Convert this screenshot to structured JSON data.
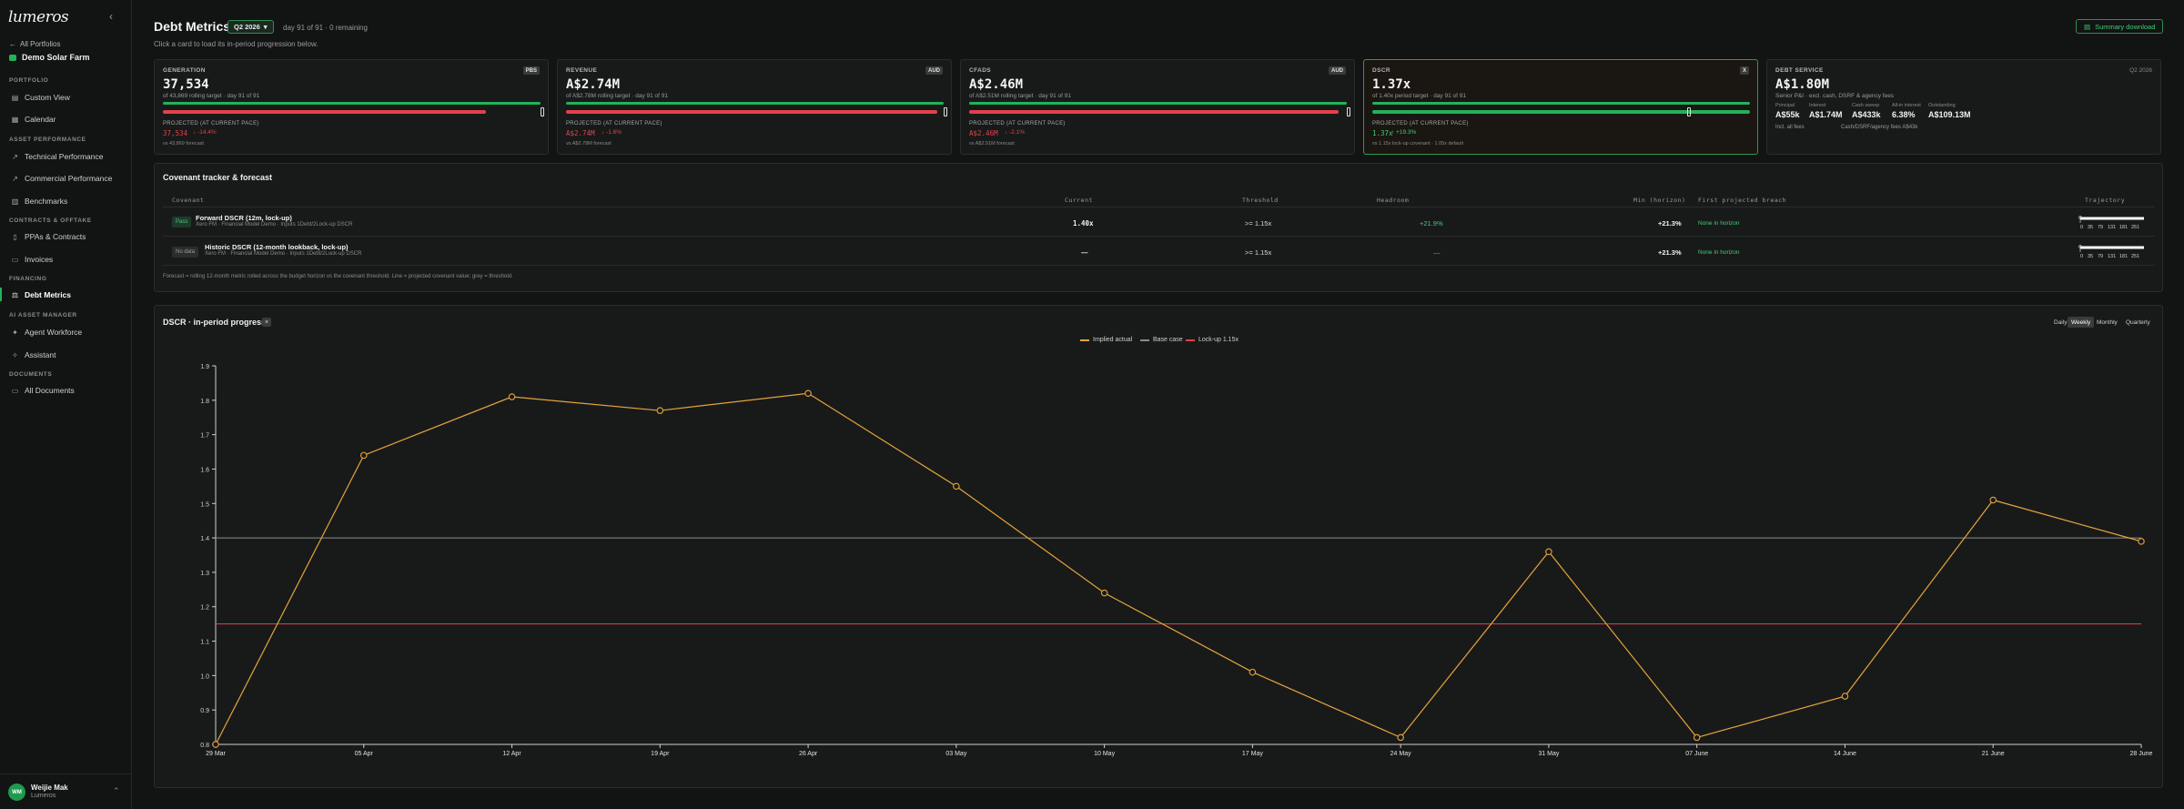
{
  "sidebar": {
    "logo": "lumeros",
    "back_label": "All Portfolios",
    "site_name": "Demo Solar Farm",
    "sections": {
      "portfolio": "PORTFOLIO",
      "asset_performance": "ASSET PERFORMANCE",
      "contracts": "CONTRACTS & OFFTAKE",
      "financing": "FINANCING",
      "ai": "AI ASSET MANAGER",
      "documents": "DOCUMENTS"
    },
    "items": {
      "custom_view": "Custom View",
      "calendar": "Calendar",
      "technical": "Technical Performance",
      "commercial": "Commercial Performance",
      "benchmarks": "Benchmarks",
      "ppas": "PPAs & Contracts",
      "invoices": "Invoices",
      "debt_metrics": "Debt Metrics",
      "agent_workforce": "Agent Workforce",
      "assistant": "Assistant",
      "all_documents": "All Documents"
    },
    "user": {
      "initials": "WM",
      "name": "Weijie Mak",
      "org": "Lumeros"
    }
  },
  "header": {
    "title": "Debt Metrics",
    "period": "Q2 2026",
    "day_status": "day 91 of 91 · 0 remaining",
    "hint": "Click a card to load its in-period progression below.",
    "summary_button": "Summary download"
  },
  "cards": [
    {
      "label": "GENERATION",
      "badge": "PBS",
      "value": "37,534",
      "sub": "of 43,869 rolling target · day 91 of 91",
      "target_fraction": 1.0,
      "projected_fraction": 0.856,
      "proj_label": "PROJECTED (AT CURRENT PACE)",
      "proj_value": "37,534",
      "proj_delta": "↓ -14.4%",
      "foot": "vs 43,869 forecast"
    },
    {
      "label": "REVENUE",
      "badge": "AUD",
      "value": "A$2.74M",
      "sub": "of A$2.78M rolling target · day 91 of 91",
      "target_fraction": 1.0,
      "projected_fraction": 0.982,
      "proj_label": "PROJECTED (AT CURRENT PACE)",
      "proj_value": "A$2.74M",
      "proj_delta": "↓ -1.6%",
      "foot": "vs A$2.78M forecast"
    },
    {
      "label": "CFADS",
      "badge": "AUD",
      "value": "A$2.46M",
      "sub": "of A$2.51M rolling target · day 91 of 91",
      "target_fraction": 1.0,
      "projected_fraction": 0.979,
      "proj_label": "PROJECTED (AT CURRENT PACE)",
      "proj_value": "A$2.46M",
      "proj_delta": "↓ -2.1%",
      "foot": "vs A$2.51M forecast"
    },
    {
      "label": "DSCR",
      "badge": "X",
      "value": "1.37x",
      "sub": "of 1.40x period target · day 91 of 91",
      "target_fraction": 1.0,
      "projected_fraction": 1.0,
      "proj_label": "PROJECTED (AT CURRENT PACE)",
      "proj_value": "1.37x",
      "proj_delta": "↑ +19.3%",
      "foot": "vs 1.15x lock-up covenant · 1.05x default"
    }
  ],
  "debt_service": {
    "label": "DEBT SERVICE",
    "period": "Q2 2026",
    "value": "A$1.80M",
    "sub": "Senior P&I · excl. cash, DSRF & agency fees",
    "metrics": [
      {
        "k": "Principal",
        "v": "A$55k"
      },
      {
        "k": "Interest",
        "v": "A$1.74M"
      },
      {
        "k": "Cash sweep",
        "v": "A$433k"
      },
      {
        "k": "All-in interest",
        "v": "6.38%"
      },
      {
        "k": "Outstanding",
        "v": "A$109.13M"
      }
    ],
    "fees_label": "Incl. all fees",
    "fees_detail": "Cash/DSRF/agency fees A$43k"
  },
  "covenant": {
    "title": "Covenant tracker & forecast",
    "headers": {
      "covenant": "Covenant",
      "current": "Current",
      "threshold": "Threshold",
      "headroom": "Headroom",
      "min": "Min (horizon)",
      "breach": "First projected breach",
      "trajectory": "Trajectory"
    },
    "rows": [
      {
        "status": "Pass",
        "name": "Forward DSCR (12m, lock-up)",
        "source": "Xero FM · Financial Model Demo · Inputs 1Debt/2Lock-up DSCR",
        "current": "1.40x",
        "threshold": ">= 1.15x",
        "headroom": "+21.9%",
        "min": "+21.3%",
        "breach": "None in horizon"
      },
      {
        "status": "No data",
        "name": "Historic DSCR (12-month lookback, lock-up)",
        "source": "Xero FM · Financial Model Demo · Inputs 1Debt/2Lock-up DSCR",
        "current": "—",
        "threshold": ">= 1.15x",
        "headroom": "—",
        "min": "+21.3%",
        "breach": "None in horizon"
      }
    ],
    "trajectory_ticks": [
      "0",
      "35",
      "79",
      "131",
      "181",
      "251"
    ],
    "note": "Forecast = rolling 12-month metric rolled across the budget horizon vs the covenant threshold. Line = projected covenant value; grey = threshold."
  },
  "chart_panel": {
    "title": "DSCR · in-period progress",
    "close": "×",
    "granularity": [
      "Daily",
      "Weekly",
      "Monthly",
      "Quarterly"
    ],
    "active_granularity": "Weekly"
  },
  "chart_data": {
    "type": "line",
    "x": [
      "29 Mar",
      "05 Apr",
      "12 Apr",
      "19 Apr",
      "26 Apr",
      "03 May",
      "10 May",
      "17 May",
      "24 May",
      "31 May",
      "07 June",
      "14 June",
      "21 June",
      "28 June"
    ],
    "series": [
      {
        "name": "Implied actual",
        "color": "#e6a33c",
        "values": [
          0.8,
          1.64,
          1.81,
          1.77,
          1.82,
          1.55,
          1.24,
          1.01,
          0.82,
          1.36,
          0.82,
          0.94,
          1.51,
          1.39
        ]
      }
    ],
    "reference_lines": [
      {
        "name": "Base case",
        "value": 1.4,
        "color": "#8a8a8a"
      },
      {
        "name": "Lock-up 1.15x",
        "value": 1.15,
        "color": "#e4414a"
      }
    ],
    "y_ticks": [
      "0.8",
      "0.9",
      "1.0",
      "1.1",
      "1.2",
      "1.3",
      "1.4",
      "1.5",
      "1.6",
      "1.7",
      "1.8",
      "1.9"
    ],
    "ylim": [
      0.8,
      1.9
    ],
    "grid": false,
    "legend_position": "top-center"
  }
}
